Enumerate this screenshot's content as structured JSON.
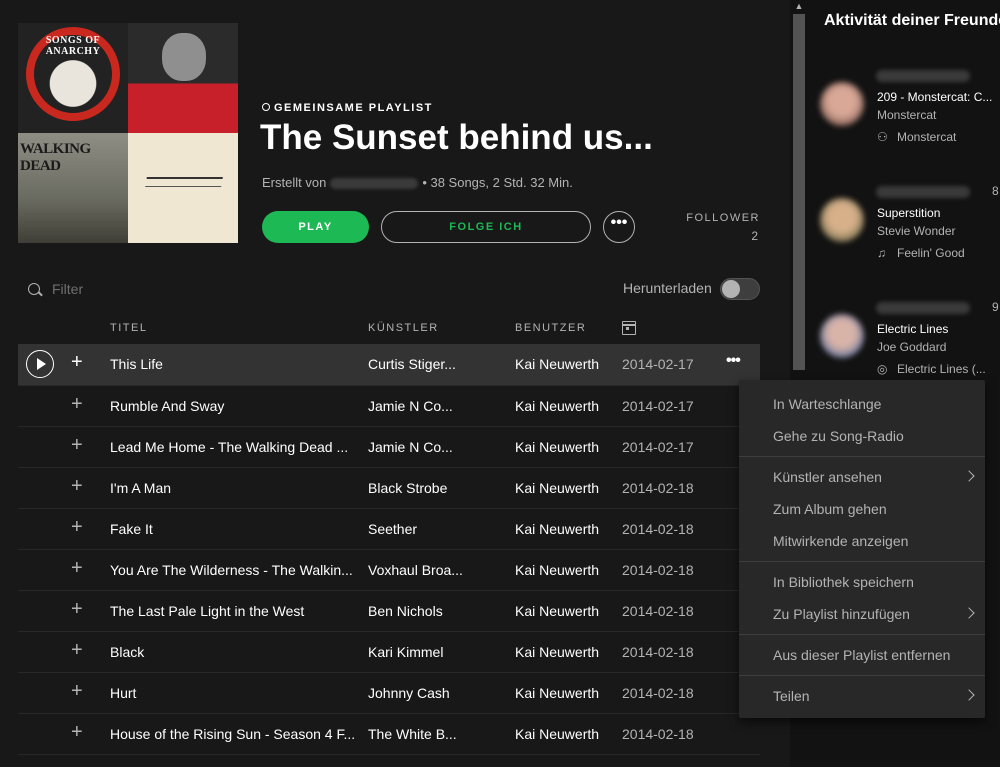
{
  "playlist": {
    "type_label": "GEMEINSAME PLAYLIST",
    "title": "The Sunset behind us...",
    "created_by_label": "Erstellt von",
    "stats": "• 38 Songs, 2 Std. 32 Min.",
    "play_label": "PLAY",
    "follow_label": "FOLGE ICH",
    "more_label": "•••",
    "followers_label": "FOLLOWER",
    "followers_count": "2",
    "cover_texts": [
      "SONGS OF ANARCHY",
      "WALKING DEAD"
    ]
  },
  "toolbar": {
    "filter_placeholder": "Filter",
    "download_label": "Herunterladen"
  },
  "columns": {
    "title": "TITEL",
    "artist": "KÜNSTLER",
    "user": "BENUTZER"
  },
  "tracks": [
    {
      "title": "This Life",
      "artist": "Curtis Stiger...",
      "user": "Kai Neuwerth",
      "date": "2014-02-17"
    },
    {
      "title": "Rumble And Sway",
      "artist": "Jamie N Co...",
      "user": "Kai Neuwerth",
      "date": "2014-02-17"
    },
    {
      "title": "Lead Me Home - The Walking Dead ...",
      "artist": "Jamie N Co...",
      "user": "Kai Neuwerth",
      "date": "2014-02-17"
    },
    {
      "title": "I'm A Man",
      "artist": "Black Strobe",
      "user": "Kai Neuwerth",
      "date": "2014-02-18"
    },
    {
      "title": "Fake It",
      "artist": "Seether",
      "user": "Kai Neuwerth",
      "date": "2014-02-18"
    },
    {
      "title": "You Are The Wilderness - The Walkin...",
      "artist": "Voxhaul Broa...",
      "user": "Kai Neuwerth",
      "date": "2014-02-18"
    },
    {
      "title": "The Last Pale Light in the West",
      "artist": "Ben Nichols",
      "user": "Kai Neuwerth",
      "date": "2014-02-18"
    },
    {
      "title": "Black",
      "artist": "Kari Kimmel",
      "user": "Kai Neuwerth",
      "date": "2014-02-18"
    },
    {
      "title": "Hurt",
      "artist": "Johnny Cash",
      "user": "Kai Neuwerth",
      "date": "2014-02-18"
    },
    {
      "title": "House of the Rising Sun - Season 4 F...",
      "artist": "The White B...",
      "user": "Kai Neuwerth",
      "date": "2014-02-18"
    }
  ],
  "context_menu": {
    "items": [
      "In Warteschlange",
      "Gehe zu Song-Radio",
      "Künstler ansehen",
      "Zum Album gehen",
      "Mitwirkende anzeigen",
      "In Bibliothek speichern",
      "Zu Playlist hinzufügen",
      "Aus dieser Playlist entfernen",
      "Teilen"
    ]
  },
  "friends": {
    "title": "Aktivität deiner Freunde",
    "items": [
      {
        "line1": "209 - Monstercat: C...",
        "line2": "Monstercat",
        "context": "Monstercat",
        "context_icon": "user-group-icon",
        "time": ""
      },
      {
        "line1": "Superstition",
        "line2": "Stevie Wonder",
        "context": "Feelin' Good",
        "context_icon": "music-note-icon",
        "time": "8"
      },
      {
        "line1": "Electric Lines",
        "line2": "Joe Goddard",
        "context": "Electric Lines (...",
        "context_icon": "album-icon",
        "time": "9"
      }
    ]
  },
  "colors": {
    "accent": "#1db954",
    "background": "#181818",
    "menu": "#282828"
  }
}
